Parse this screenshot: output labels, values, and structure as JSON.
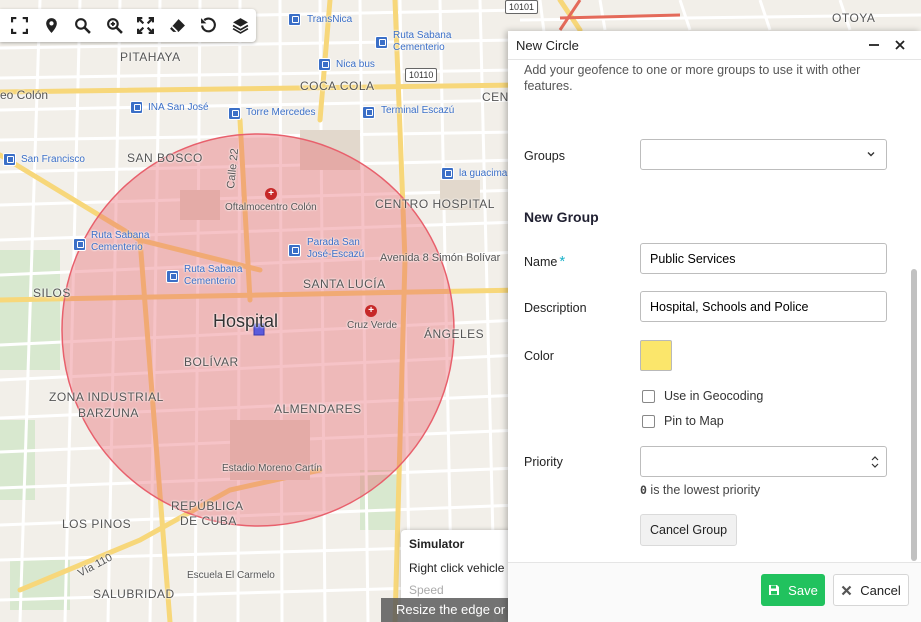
{
  "map": {
    "hospital_label": "Hospital",
    "areas": [
      "PITAHAYA",
      "COCA COLA",
      "CEN",
      "SAN BOSCO",
      "CENTRO HOSPITAL",
      "SILOS",
      "SANTA LUCÍA",
      "ÁNGELES",
      "BOLÍVAR",
      "ZONA INDUSTRIAL",
      "BARZUNA",
      "ALMENDARES",
      "REPÚBLICA",
      "DE CUBA",
      "LOS PINOS",
      "SALUBRIDAD",
      "OTOYA",
      "eo Colón"
    ],
    "streets": [
      "Calle 22",
      "Avenida 8 Simón Bolívar",
      "Vía 110"
    ],
    "pois": [
      "Oftalmocentro Colón",
      "Cruz Verde",
      "Estadio Moreno Cartín",
      "Escuela El Carmelo"
    ],
    "bus_stops": [
      "TransNica",
      "Ruta Sabana Cementerio",
      "Nica bus",
      "INA San José",
      "Torre Mercedes",
      "Terminal Escazú",
      "San Francisco",
      "la guacima",
      "Ruta Sabana Cementerio",
      "Parada San José-Escazú",
      "Ruta Sabana Cementerio"
    ],
    "road_numbers": [
      "10101",
      "10110"
    ],
    "geofence_color": "#e8606c"
  },
  "toolbar": {
    "icons": [
      "fullscreen-icon",
      "marker-icon",
      "search-icon",
      "zoom-in-icon",
      "fit-bounds-icon",
      "eraser-icon",
      "undo-icon",
      "layers-icon"
    ]
  },
  "simulator": {
    "title": "Simulator",
    "description": "Right click vehicle",
    "speed_label": "Speed"
  },
  "hint": "Resize the edge or move the circle",
  "panel": {
    "title": "New Circle",
    "description": "Add your geofence to one or more groups to use it with other features.",
    "groups_label": "Groups",
    "groups_value": "",
    "section_title": "New Group",
    "name_label": "Name",
    "name_required": "*",
    "name_value": "Public Services",
    "description_label": "Description",
    "description_value": "Hospital, Schools and Police",
    "color_label": "Color",
    "color_value": "#fbe66b",
    "use_geocoding_label": "Use in Geocoding",
    "pin_to_map_label": "Pin to Map",
    "priority_label": "Priority",
    "priority_value": "",
    "priority_hint_code": "0",
    "priority_hint_text": "is the lowest priority",
    "cancel_group_label": "Cancel Group",
    "save_label": "Save",
    "cancel_label": "Cancel"
  }
}
